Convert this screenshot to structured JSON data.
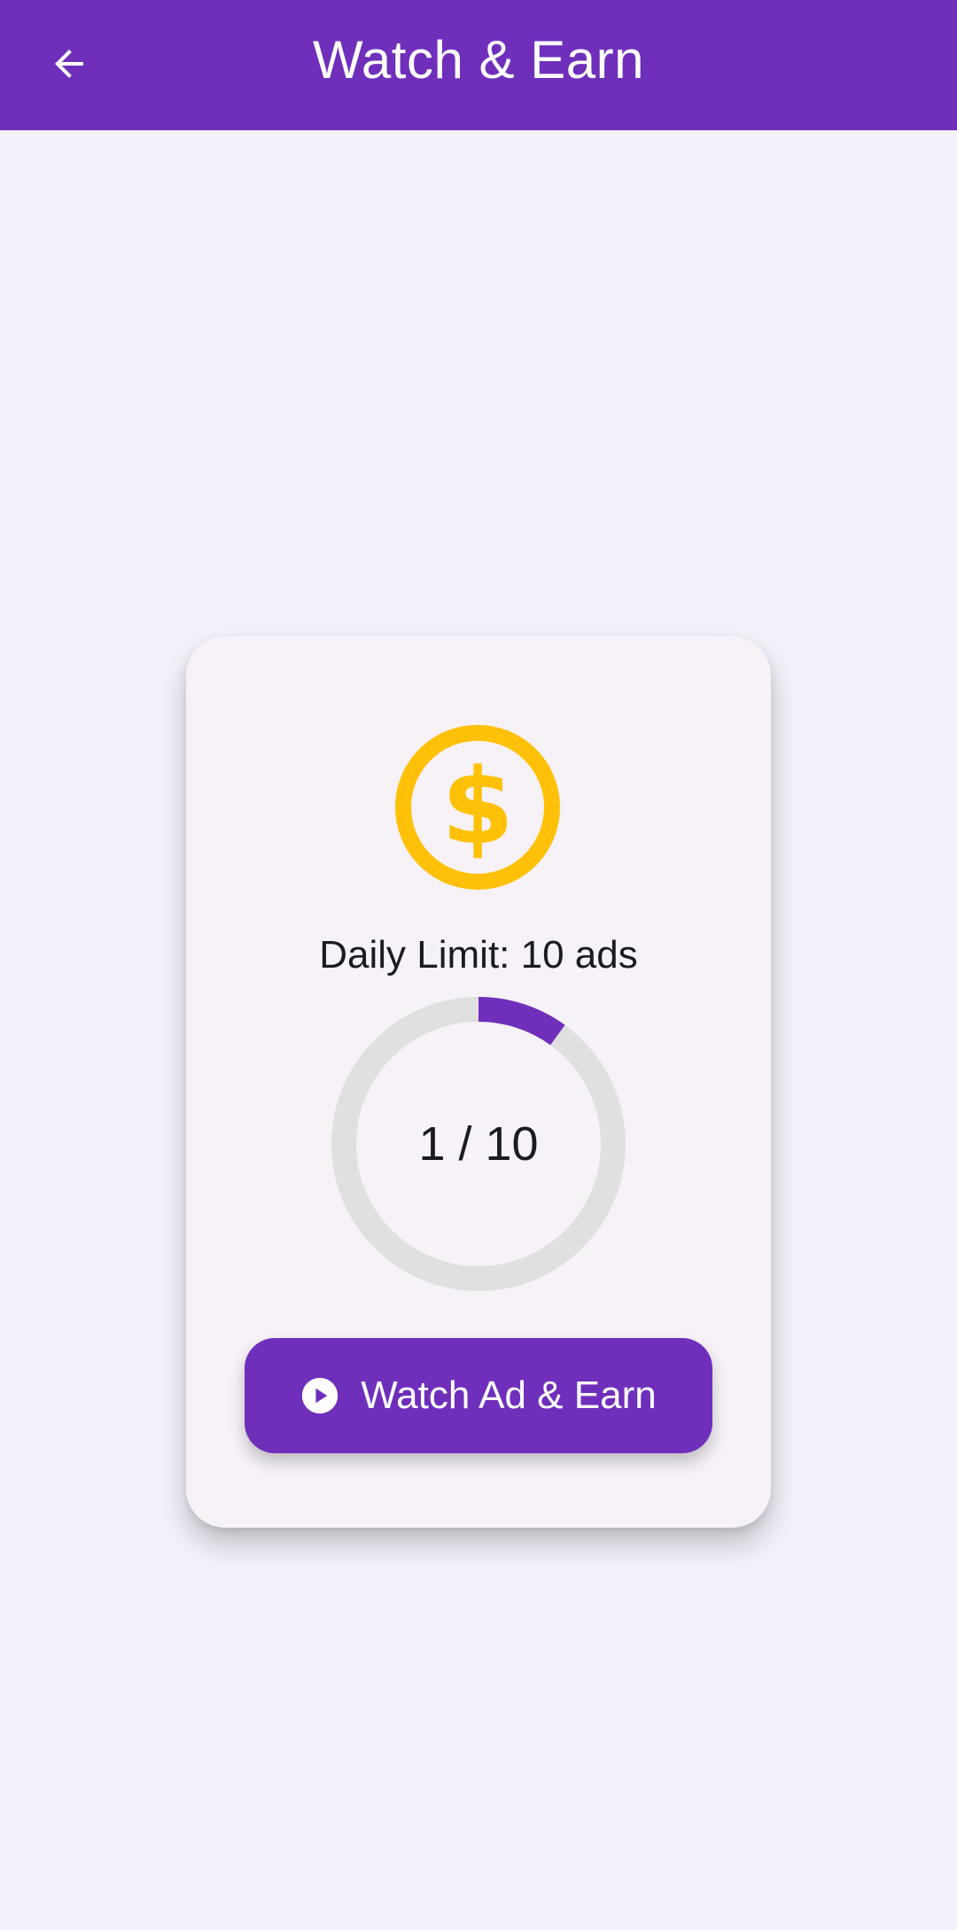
{
  "header": {
    "title": "Watch & Earn",
    "back_icon": "arrow-back-icon"
  },
  "card": {
    "icon": "dollar-coin-icon",
    "daily_limit_text": "Daily Limit: 10 ads",
    "progress": {
      "watched": 1,
      "limit": 10,
      "label": "1 / 10"
    },
    "button": {
      "icon": "play-circle-icon",
      "label": "Watch Ad & Earn"
    }
  },
  "colors": {
    "primary": "#6f2fbb",
    "coin": "#ffc107",
    "track": "#e0e0e0",
    "background": "#f3f1fa",
    "card": "#f6f2f8"
  }
}
